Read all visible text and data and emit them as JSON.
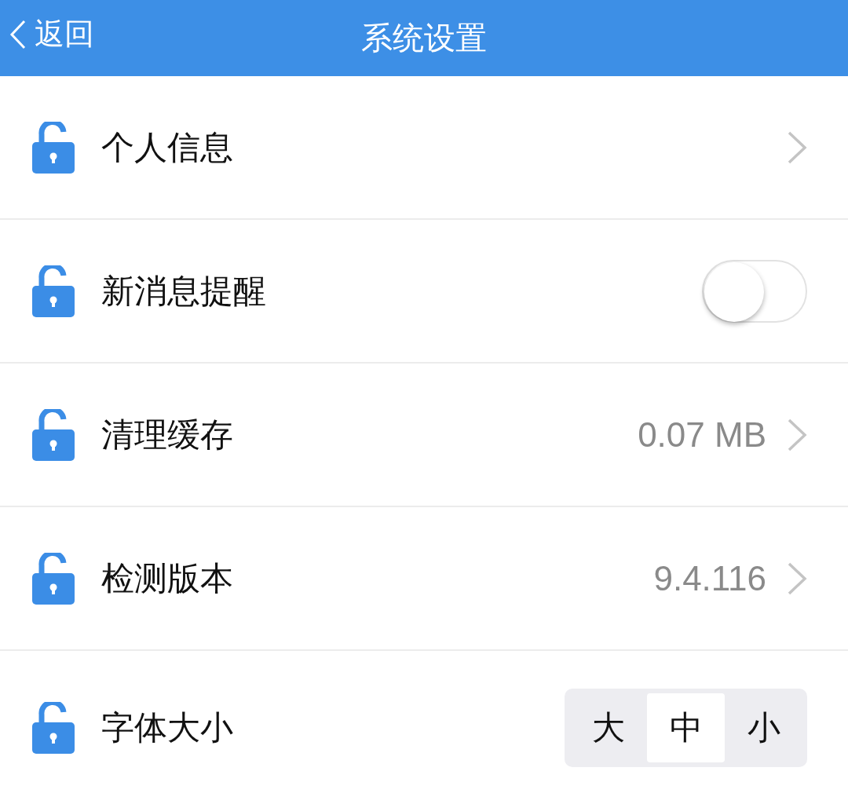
{
  "header": {
    "back_label": "返回",
    "title": "系统设置"
  },
  "rows": [
    {
      "kind": "link",
      "label": "个人信息"
    },
    {
      "kind": "toggle",
      "label": "新消息提醒",
      "on": false
    },
    {
      "kind": "link",
      "label": "清理缓存",
      "value": "0.07 MB"
    },
    {
      "kind": "link",
      "label": "检测版本",
      "value": "9.4.116"
    },
    {
      "kind": "segmented",
      "label": "字体大小",
      "options": [
        {
          "label": "大",
          "selected": false
        },
        {
          "label": "中",
          "selected": true
        },
        {
          "label": "小",
          "selected": false
        }
      ]
    }
  ]
}
